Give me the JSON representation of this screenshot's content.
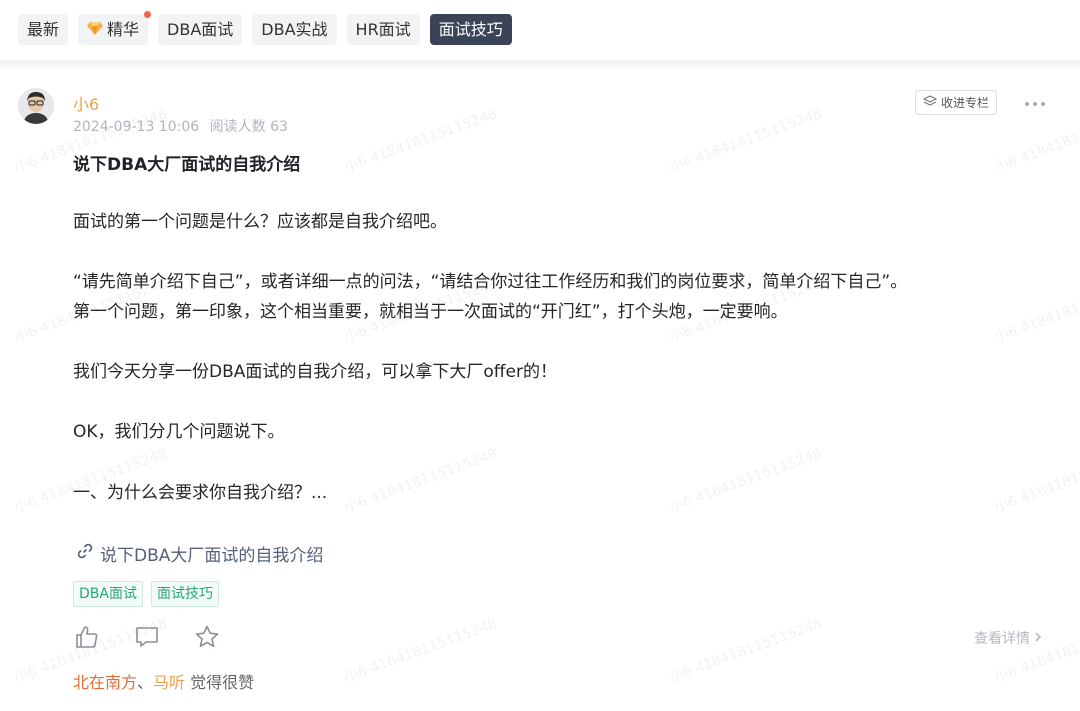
{
  "tabs": [
    {
      "label": "最新",
      "active": false
    },
    {
      "label": "精华",
      "active": false,
      "icon": "gem-icon",
      "badge_dot": true
    },
    {
      "label": "DBA面试",
      "active": false
    },
    {
      "label": "DBA实战",
      "active": false
    },
    {
      "label": "HR面试",
      "active": false
    },
    {
      "label": "面试技巧",
      "active": true
    }
  ],
  "post": {
    "author": "小6",
    "date": "2024-09-13 10:06",
    "views": "阅读人数 63",
    "collect_label": "收进专栏",
    "title": "说下DBA大厂面试的自我介绍",
    "paragraphs": [
      "面试的第一个问题是什么？应该都是自我介绍吧。",
      "“请先简单介绍下自己”，或者详细一点的问法，“请结合你过往工作经历和我们的岗位要求，简单介绍下自己”。",
      "第一个问题，第一印象，这个相当重要，就相当于一次面试的“开门红”，打个头炮，一定要响。",
      "我们今天分享一份DBA面试的自我介绍，可以拿下大厂offer的！",
      "OK，我们分几个问题说下。",
      "一、为什么会要求你自我介绍？..."
    ],
    "link_text": "说下DBA大厂面试的自我介绍",
    "tags": [
      "DBA面试",
      "面试技巧"
    ],
    "detail_label": "查看详情",
    "likers": [
      "北在南方",
      "马听"
    ],
    "liker_sep": "、",
    "likes_suffix": " 觉得很赞"
  },
  "watermark_text": "小6 418418115115248",
  "colors": {
    "accent": "#f0a04b",
    "active_tab": "#3b4357",
    "tag_green": "#26a97a",
    "link": "#55617a"
  }
}
